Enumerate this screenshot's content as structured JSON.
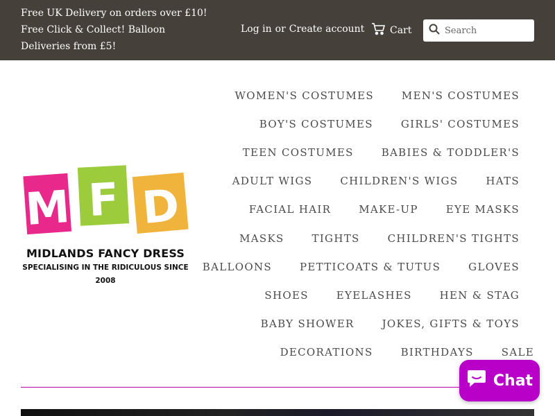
{
  "promo": {
    "line1": "Free UK Delivery on orders over £10!",
    "line2": "Free Click & Collect! Balloon Deliveries from £5!"
  },
  "account": {
    "login": "Log in",
    "or": "or",
    "create": "Create account"
  },
  "cart": {
    "label": "Cart",
    "icon": "cart-icon"
  },
  "search": {
    "placeholder": "Search",
    "icon": "search-icon"
  },
  "logo": {
    "letters": [
      "M",
      "F",
      "D"
    ],
    "name": "MIDLANDS FANCY DRESS",
    "tagline": "SPECIALISING IN THE RIDICULOUS SINCE 2008"
  },
  "nav": {
    "rows": [
      [
        "WOMEN'S COSTUMES",
        "MEN'S COSTUMES"
      ],
      [
        "BOY'S COSTUMES",
        "GIRLS' COSTUMES"
      ],
      [
        "TEEN COSTUMES",
        "BABIES & TODDLER'S"
      ],
      [
        "ADULT WIGS",
        "CHILDREN'S WIGS",
        "HATS"
      ],
      [
        "FACIAL HAIR",
        "MAKE-UP",
        "EYE MASKS"
      ],
      [
        "MASKS",
        "TIGHTS",
        "CHILDREN'S TIGHTS"
      ],
      [
        "BALLOONS",
        "PETTICOATS & TUTUS",
        "GLOVES"
      ],
      [
        "SHOES",
        "EYELASHES",
        "HEN & STAG"
      ],
      [
        "BABY SHOWER",
        "JOKES, GIFTS & TOYS"
      ],
      [
        "DECORATIONS",
        "BIRTHDAYS",
        "SALE"
      ]
    ]
  },
  "chat": {
    "label": "Chat",
    "icon": "chat-bubble-icon"
  },
  "colors": {
    "topbar": "#45403a",
    "divider": "#b800a6",
    "chat": "#b800c9",
    "logo_pink": "#e8288a",
    "logo_green": "#9ccc3c",
    "logo_orange": "#f0b43c"
  }
}
